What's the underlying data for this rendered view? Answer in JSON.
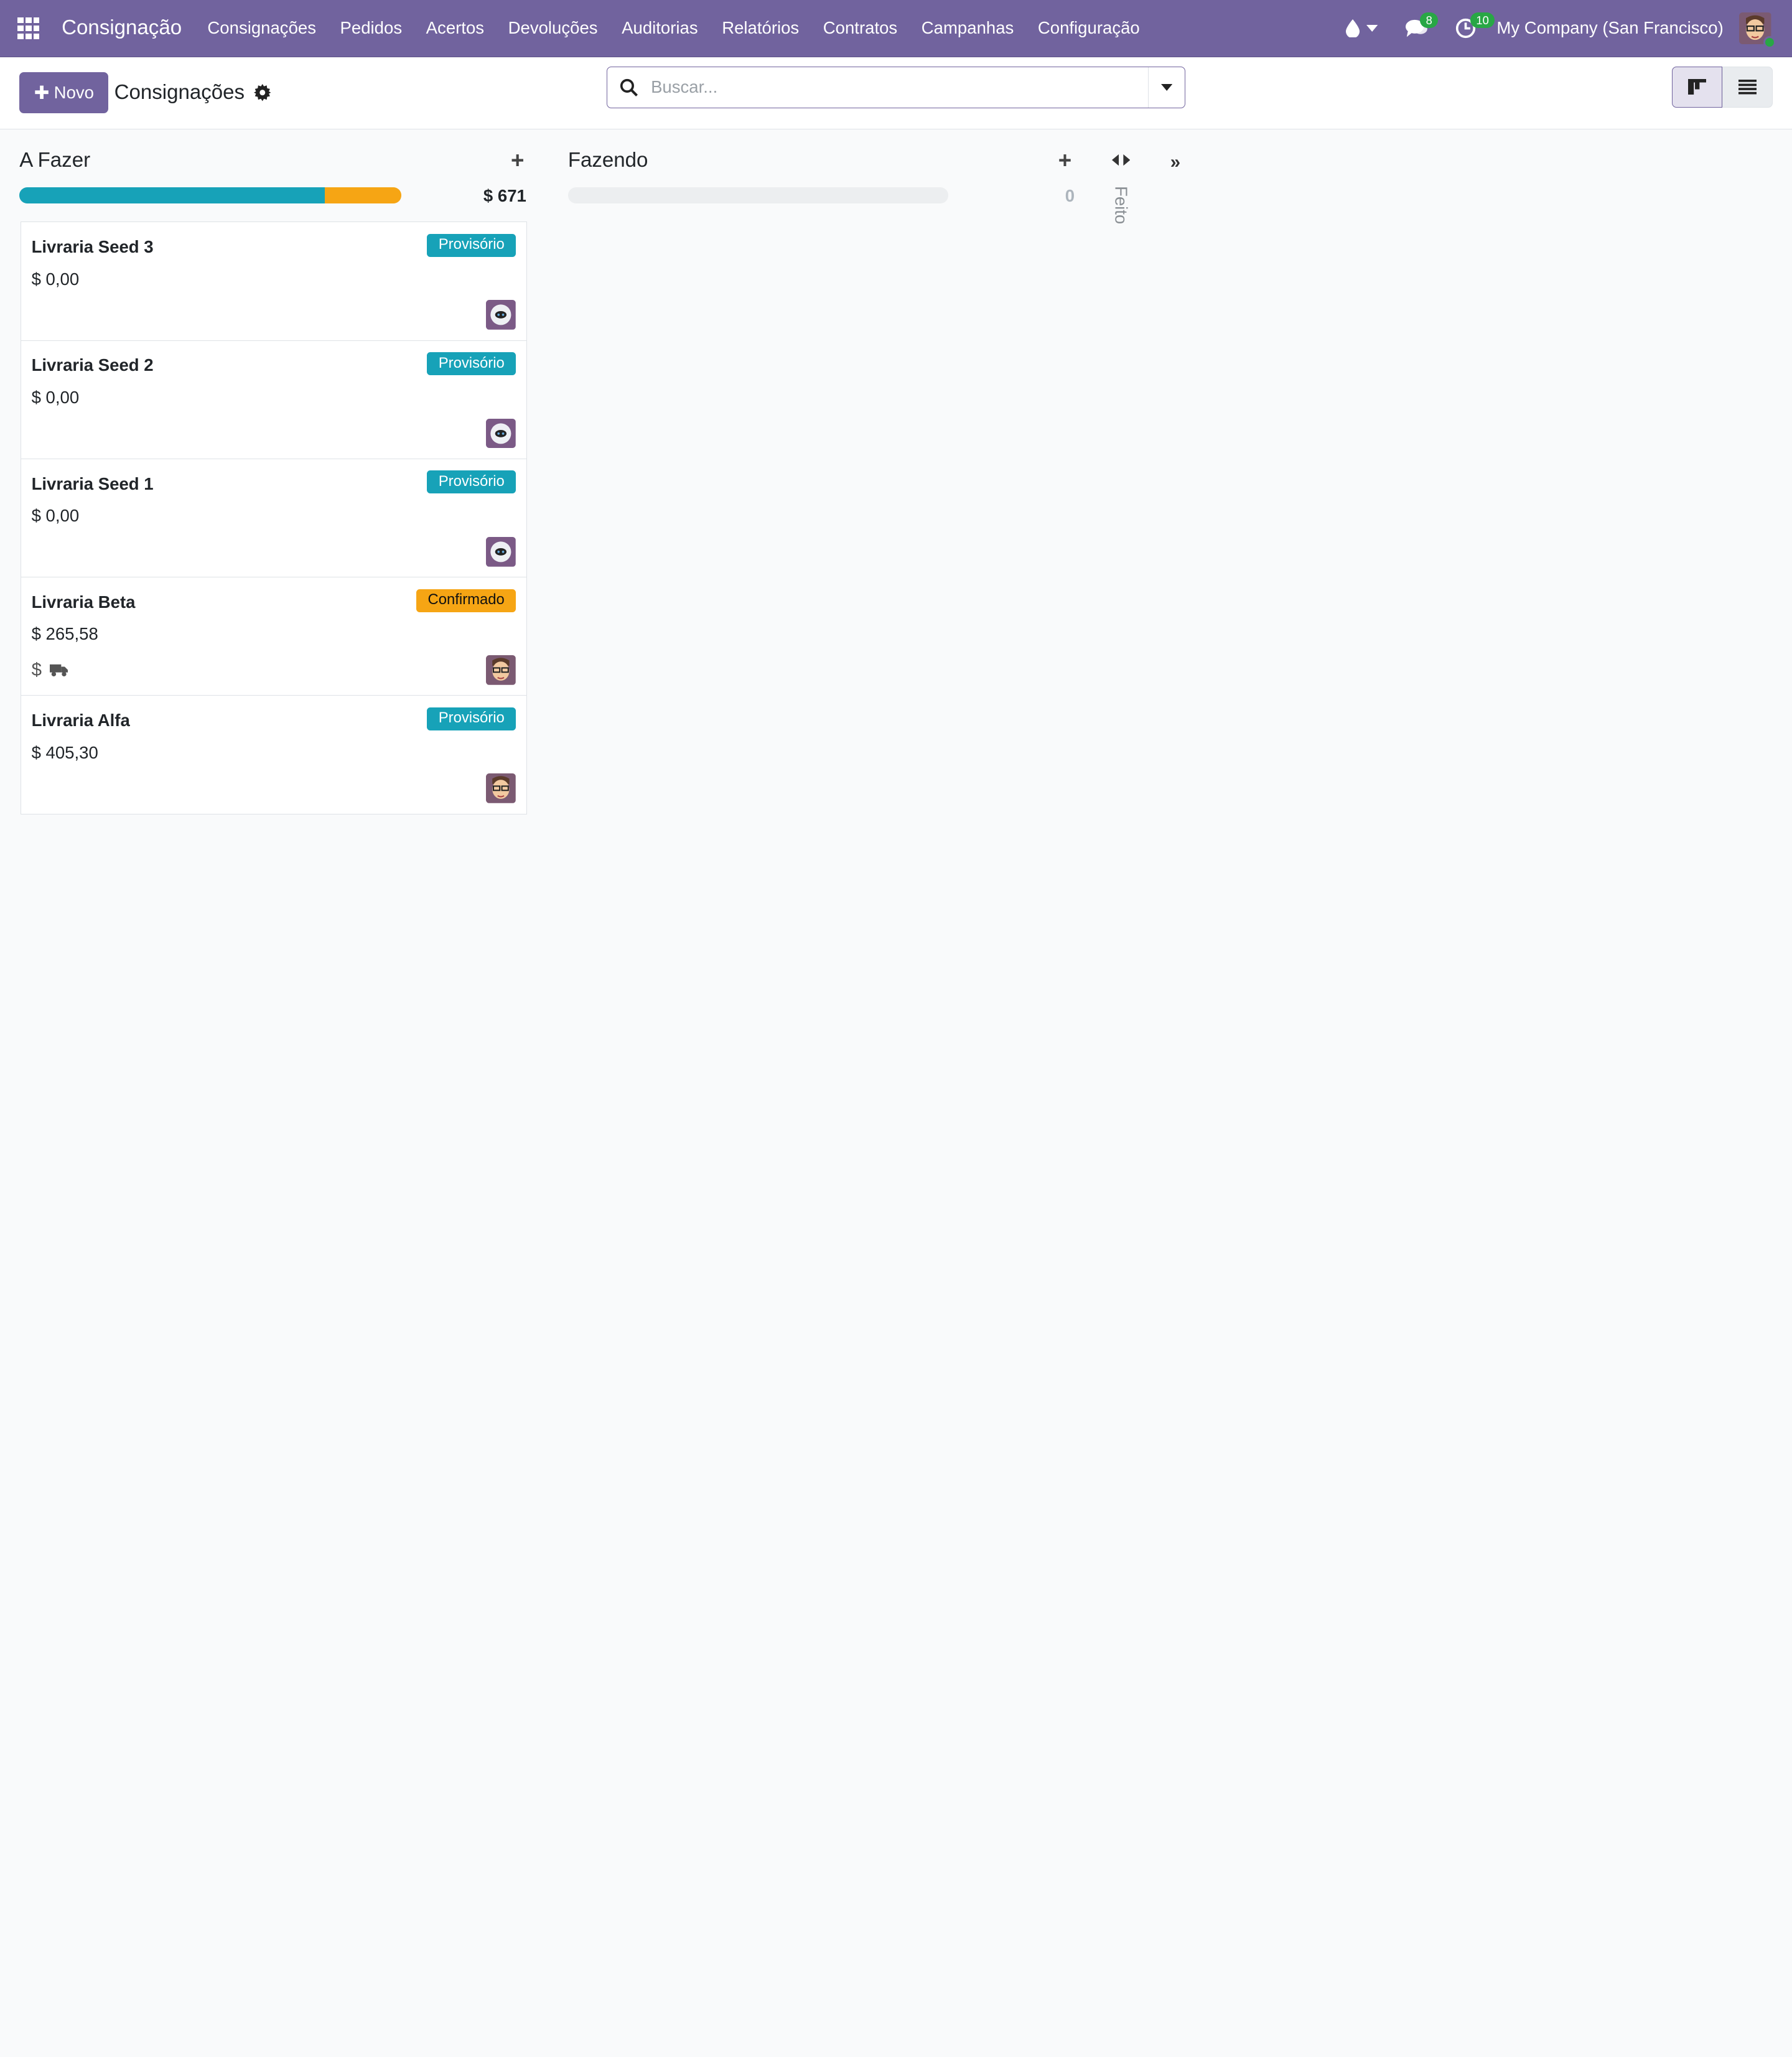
{
  "navbar": {
    "app_name": "Consignação",
    "menu": [
      "Consignações",
      "Pedidos",
      "Acertos",
      "Devoluções",
      "Auditorias",
      "Relatórios",
      "Contratos",
      "Campanhas",
      "Configuração"
    ],
    "messages_count": "8",
    "activities_count": "10",
    "company": "My Company (San Francisco)",
    "icons": [
      "apps-icon",
      "drop-icon",
      "chat-icon",
      "clock-icon"
    ]
  },
  "control": {
    "new_label": "Novo",
    "breadcrumb": "Consignações",
    "search_placeholder": "Buscar..."
  },
  "kanban": {
    "columns": [
      {
        "title": "A Fazer",
        "total": "$ 671",
        "progress": {
          "teal": 0.8,
          "orange": 0.2
        }
      },
      {
        "title": "Fazendo",
        "total": "0",
        "progress": {
          "teal": 0,
          "orange": 0
        }
      },
      {
        "title": "Feito",
        "folded": true
      }
    ],
    "cards": [
      {
        "title": "Livraria Seed 3",
        "amount": "$ 0,00",
        "status": "Provisório",
        "avatar": "bot"
      },
      {
        "title": "Livraria Seed 2",
        "amount": "$ 0,00",
        "status": "Provisório",
        "avatar": "bot"
      },
      {
        "title": "Livraria Seed 1",
        "amount": "$ 0,00",
        "status": "Provisório",
        "avatar": "bot"
      },
      {
        "title": "Livraria Beta",
        "amount": "$ 265,58",
        "status": "Confirmado",
        "avatar": "user",
        "icons": [
          "dollar-icon",
          "truck-icon"
        ]
      },
      {
        "title": "Livraria Alfa",
        "amount": "$ 405,30",
        "status": "Provisório",
        "avatar": "user"
      }
    ]
  },
  "colors": {
    "brand": "#71639e",
    "provisorio": "#17a2b8",
    "confirmado": "#f6a514"
  }
}
